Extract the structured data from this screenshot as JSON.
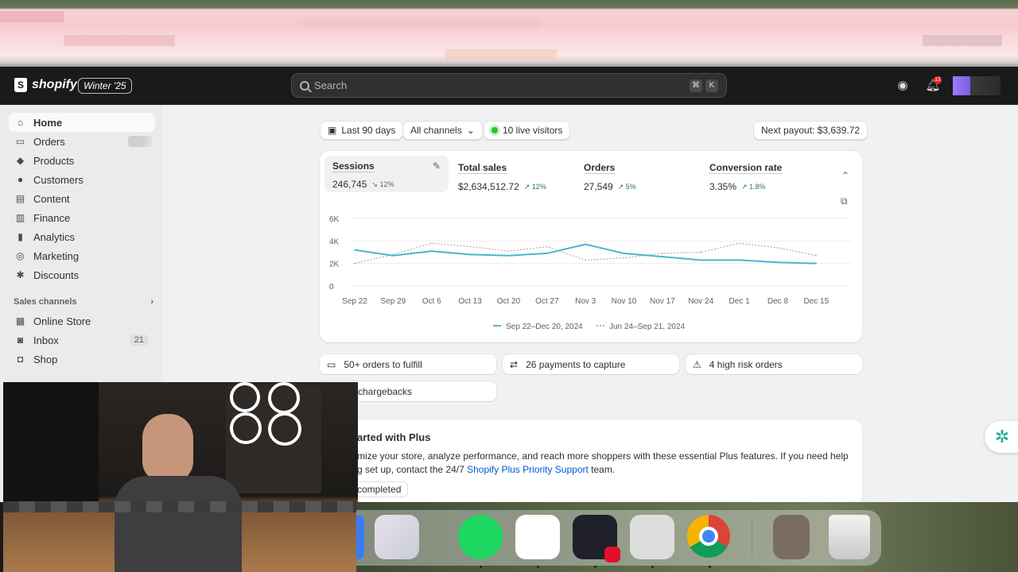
{
  "header": {
    "brand": "shopify",
    "edition": "Winter '25",
    "search_placeholder": "Search",
    "shortcut_keys": [
      "⌘",
      "K"
    ],
    "notification_count": "12"
  },
  "sidebar": {
    "items": [
      {
        "label": "Home",
        "icon": "home-icon",
        "active": true
      },
      {
        "label": "Orders",
        "icon": "inbox-tray-icon"
      },
      {
        "label": "Products",
        "icon": "tag-icon"
      },
      {
        "label": "Customers",
        "icon": "person-icon"
      },
      {
        "label": "Content",
        "icon": "content-icon"
      },
      {
        "label": "Finance",
        "icon": "bank-icon"
      },
      {
        "label": "Analytics",
        "icon": "bar-chart-icon"
      },
      {
        "label": "Marketing",
        "icon": "target-icon"
      },
      {
        "label": "Discounts",
        "icon": "discount-icon"
      }
    ],
    "sales_channels_label": "Sales channels",
    "channels": [
      {
        "label": "Online Store",
        "icon": "store-icon"
      },
      {
        "label": "Inbox",
        "icon": "inbox-icon",
        "count": "21"
      },
      {
        "label": "Shop",
        "icon": "shop-icon"
      }
    ]
  },
  "filters": {
    "date_range": "Last 90 days",
    "channels": "All channels",
    "live_visitors": "10 live visitors",
    "next_payout": "Next payout: $3,639.72"
  },
  "metrics": [
    {
      "label": "Sessions",
      "value": "246,745",
      "change": "12%",
      "direction": "down"
    },
    {
      "label": "Total sales",
      "value": "$2,634,512.72",
      "change": "12%",
      "direction": "up"
    },
    {
      "label": "Orders",
      "value": "27,549",
      "change": "5%",
      "direction": "up"
    },
    {
      "label": "Conversion rate",
      "value": "3.35%",
      "change": "1.8%",
      "direction": "up"
    }
  ],
  "chart_data": {
    "type": "line",
    "x": [
      "Sep 22",
      "Sep 29",
      "Oct 6",
      "Oct 13",
      "Oct 20",
      "Oct 27",
      "Nov 3",
      "Nov 10",
      "Nov 17",
      "Nov 24",
      "Dec 1",
      "Dec 8",
      "Dec 15"
    ],
    "yticks": [
      "0",
      "2K",
      "4K",
      "6K"
    ],
    "ylim": [
      0,
      6000
    ],
    "series": [
      {
        "name": "Sep 22–Dec 20, 2024",
        "style": "solid",
        "color": "#4ab5cf",
        "values": [
          3200,
          2700,
          3100,
          2800,
          2700,
          2900,
          3700,
          2900,
          2600,
          2300,
          2300,
          2100,
          2000
        ]
      },
      {
        "name": "Jun 24–Sep 21, 2024",
        "style": "dotted",
        "color": "#a9b7c0",
        "values": [
          2000,
          2800,
          3800,
          3500,
          3100,
          3500,
          2300,
          2500,
          2900,
          3000,
          3800,
          3400,
          2700
        ]
      }
    ],
    "grid": true,
    "legend": "bottom"
  },
  "actions": [
    {
      "label": "50+ orders to fulfill",
      "icon": "inbox-icon"
    },
    {
      "label": "26 payments to capture",
      "icon": "payment-icon"
    },
    {
      "label": "4 high risk orders",
      "icon": "alert-icon"
    },
    {
      "label": "chargebacks",
      "icon": "chargeback-icon"
    }
  ],
  "plus_card": {
    "title": "arted with Plus",
    "body_line1": "mize your store, analyze performance, and reach more shoppers with these essential Plus features. If you need help",
    "body_line2_prefix": "g set up, contact the 24/7 ",
    "link": "Shopify Plus Priority Support",
    "body_line2_suffix": " team.",
    "status": "completed"
  }
}
